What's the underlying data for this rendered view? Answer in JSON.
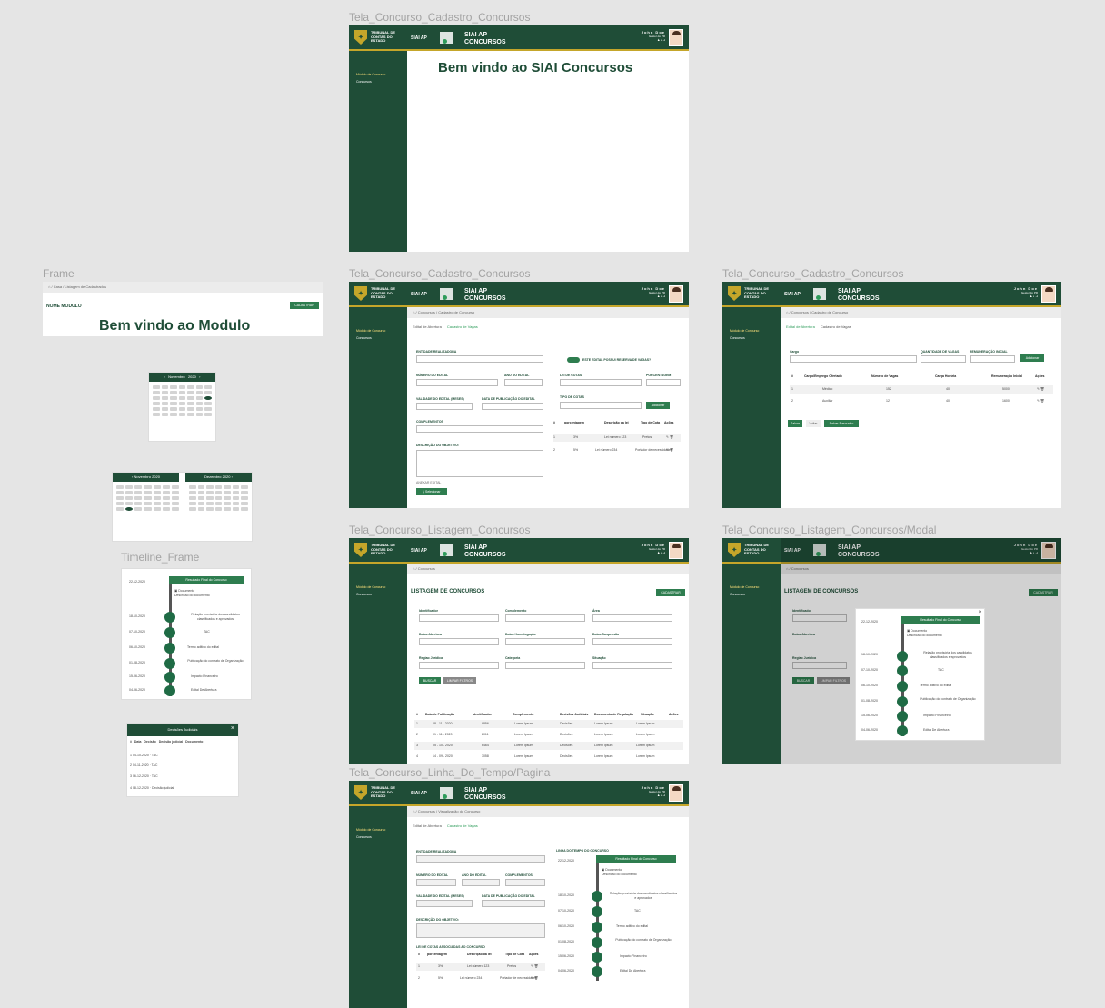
{
  "labels": {
    "f1": "Tela_Concurso_Cadastro_Concursos",
    "f2": "Tela_Concurso_Cadastro_Concursos",
    "f3": "Tela_Concurso_Cadastro_Concursos",
    "f4": "Tela_Concurso_Listagem_Concursos",
    "f5": "Tela_Concurso_Listagem_Concursos/Modal",
    "f6": "Tela_Concurso_Linha_Do_Tempo/Pagina",
    "frame": "Frame",
    "timeline": "Timeline_Frame"
  },
  "header": {
    "org": [
      "TRIBUNAL DE",
      "CONTAS DO",
      "ESTADO"
    ],
    "siai": "SIAI AP",
    "app": [
      "SIAI AP",
      "CONCURSOS"
    ],
    "user": "John Doe",
    "user_sub": "Gestor do PR"
  },
  "sidebar": {
    "item1": "Módulo de Concurso",
    "item2": "Concursos"
  },
  "home": {
    "welcome": "Bem vindo ao SIAI Concursos"
  },
  "frame_mod": {
    "breadcrumb": "Casa / Listagem de Cadastrados",
    "module": "NOME MODULO",
    "cadastrar": "CADASTRAR",
    "welcome": "Bem vindo ao Modulo"
  },
  "cad1": {
    "breadcrumb": "Concursos / Cadastro de Concurso",
    "tab1": "Edital de Abertura",
    "tab2": "Cadastro de Vagas",
    "entidade": "ENTIDADE REALIZADORA",
    "toggle": "ESTE EDITAL POSSUI RESERVA DE VAGAS?",
    "num_edital": "NÚMERO DO EDITAL",
    "ano_edital": "ANO DO EDITAL",
    "lei_cotas": "LEI DE COTAS",
    "porcentagem": "PORCENTAGEM",
    "validade": "VALIDADE DO EDITAL (MESES)",
    "data_pub": "DATA DE PUBLICAÇÃO DO EDITAL",
    "tipo_cotas": "TIPO DE COTAS",
    "adicionar": "Adicionar",
    "complementos": "COMPLEMENTOS",
    "descricao": "DESCRIÇÃO DO OBJETIVO:",
    "anexo": "ANEXAR EDITAL",
    "selecionar": "Selecionar",
    "cols": [
      "#",
      "porcentagem",
      "Descrição da lei",
      "Tipo de Cota",
      "Ações"
    ],
    "rows": [
      [
        "1",
        "3%",
        "Lei número 123",
        "Pretos"
      ],
      [
        "2",
        "5%",
        "Lei número 234",
        "Portador de necessidades"
      ]
    ]
  },
  "cad2": {
    "breadcrumb": "Concursos / Cadastro de Concurso",
    "tab1": "Edital de Abertura",
    "tab2": "Cadastro de Vagas",
    "cargo": "Cargo",
    "qtd": "QUANTIDADE DE VAGAS",
    "rem": "REMUNERAÇÃO INICIAL",
    "adicionar": "Adicionar",
    "cols": [
      "#",
      "Cargo/Emprego Ofertado",
      "Número de Vagas",
      "Carga Horária",
      "Remuneração Inicial",
      "Ações"
    ],
    "rows": [
      [
        "1",
        "Médico",
        "152",
        "40",
        "5000"
      ],
      [
        "2",
        "Auxiliar",
        "12",
        "40",
        "1600"
      ]
    ],
    "salvar": "Salvar",
    "voltar": "Voltar",
    "salvar_rascunho": "Salvar Rascunho"
  },
  "list": {
    "breadcrumb": "Concursos",
    "title": "LISTAGEM DE CONCURSOS",
    "cadastrar": "CADASTRAR",
    "identificador": "Identificador",
    "complemento": "Complemento",
    "area": "Área",
    "datas_abertura": "Datas Abertura",
    "datas_homologacao": "Datas Homologação",
    "datas_suspensao": "Datas Suspensão",
    "regiao": "Regiao Jurídica",
    "categoria": "Categoria",
    "situacao": "Situação",
    "buscar": "BUSCAR",
    "limpar": "LIMPAR FILTROS",
    "cols": [
      "#",
      "Data de Publicação",
      "Identificador",
      "Complemento",
      "Decisões Judiciais",
      "Documento de Regulação",
      "Situação",
      "Ações"
    ],
    "rows": [
      [
        "1",
        "08 - 11 - 2020",
        "9856",
        "Lorem Ipsum",
        "Decisões",
        "Lorem Ipsum",
        "Lorem Ipsum"
      ],
      [
        "2",
        "01 - 11 - 2020",
        "2011",
        "Lorem Ipsum",
        "Decisões",
        "Lorem Ipsum",
        "Lorem Ipsum"
      ],
      [
        "3",
        "05 - 10 - 2020",
        "6464",
        "Lorem Ipsum",
        "Decisões",
        "Lorem Ipsum",
        "Lorem Ipsum"
      ],
      [
        "4",
        "14 - 09 - 2020",
        "3058",
        "Lorem Ipsum",
        "Decisões",
        "Lorem Ipsum",
        "Lorem Ipsum"
      ]
    ]
  },
  "timeline": {
    "title": "LINHA DO TEMPO DO CONCURSO",
    "top_label": "Resultado Final do Concurso",
    "doc": "Documento",
    "doc_desc": "Descricao do documento",
    "events": [
      {
        "date": "22-12-2020",
        "label": "Resultado Final do Concurso"
      },
      {
        "date": "18-10-2020",
        "label": "Relação provisória dos candidatos classificados e aprovados"
      },
      {
        "date": "07-10-2020",
        "label": "TAC"
      },
      {
        "date": "06-10-2020",
        "label": "Termo aditivo do edital"
      },
      {
        "date": "01-08-2020",
        "label": "Publicação do contrato de Organização"
      },
      {
        "date": "15-06-2020",
        "label": "Impacto Financeiro"
      },
      {
        "date": "04-06-2020",
        "label": "Edital De Abertura"
      }
    ]
  },
  "decisoes": {
    "title": "Decisões Judiciais",
    "cols": [
      "#",
      "Data",
      "Decisão",
      "Decisão judicial",
      "Documento"
    ],
    "rows": [
      [
        "1",
        "04-10-2020",
        "Lorem ipsum dolor sit amet consectetur adipiscing",
        "TAC"
      ],
      [
        "2",
        "04-11-2020",
        "Lorem ipsum dolor sit amet consectetur adipiscing",
        "TAC"
      ],
      [
        "3",
        "06-12-2020",
        "Lorem ipsum dolor sit amet consectetur adipiscing",
        "TAC"
      ],
      [
        "4",
        "08-12-2020",
        "Lorem ipsum dolor sit amet consectetur adipiscing",
        "Decisão judicial"
      ]
    ]
  },
  "calendar": {
    "month": "Novembro",
    "month2": "Dezembro",
    "year": "2020"
  },
  "pagina": {
    "breadcrumb": "Concursos / Visualização do Concurso",
    "entidade": "ENTIDADE REALIZADORA",
    "num_edital": "NÚMERO DO EDITAL",
    "ano_edital": "ANO DO EDITAL",
    "complementos": "COMPLEMENTOS",
    "validade": "VALIDADE DO EDITAL (MESES)",
    "data_pub": "DATA DE PUBLICAÇÃO DO EDITAL",
    "descricao": "DESCRIÇÃO DO OBJETIVO:",
    "cotas_title": "LEI DE COTAS ASSOCIADAS AO CONCURSO"
  }
}
